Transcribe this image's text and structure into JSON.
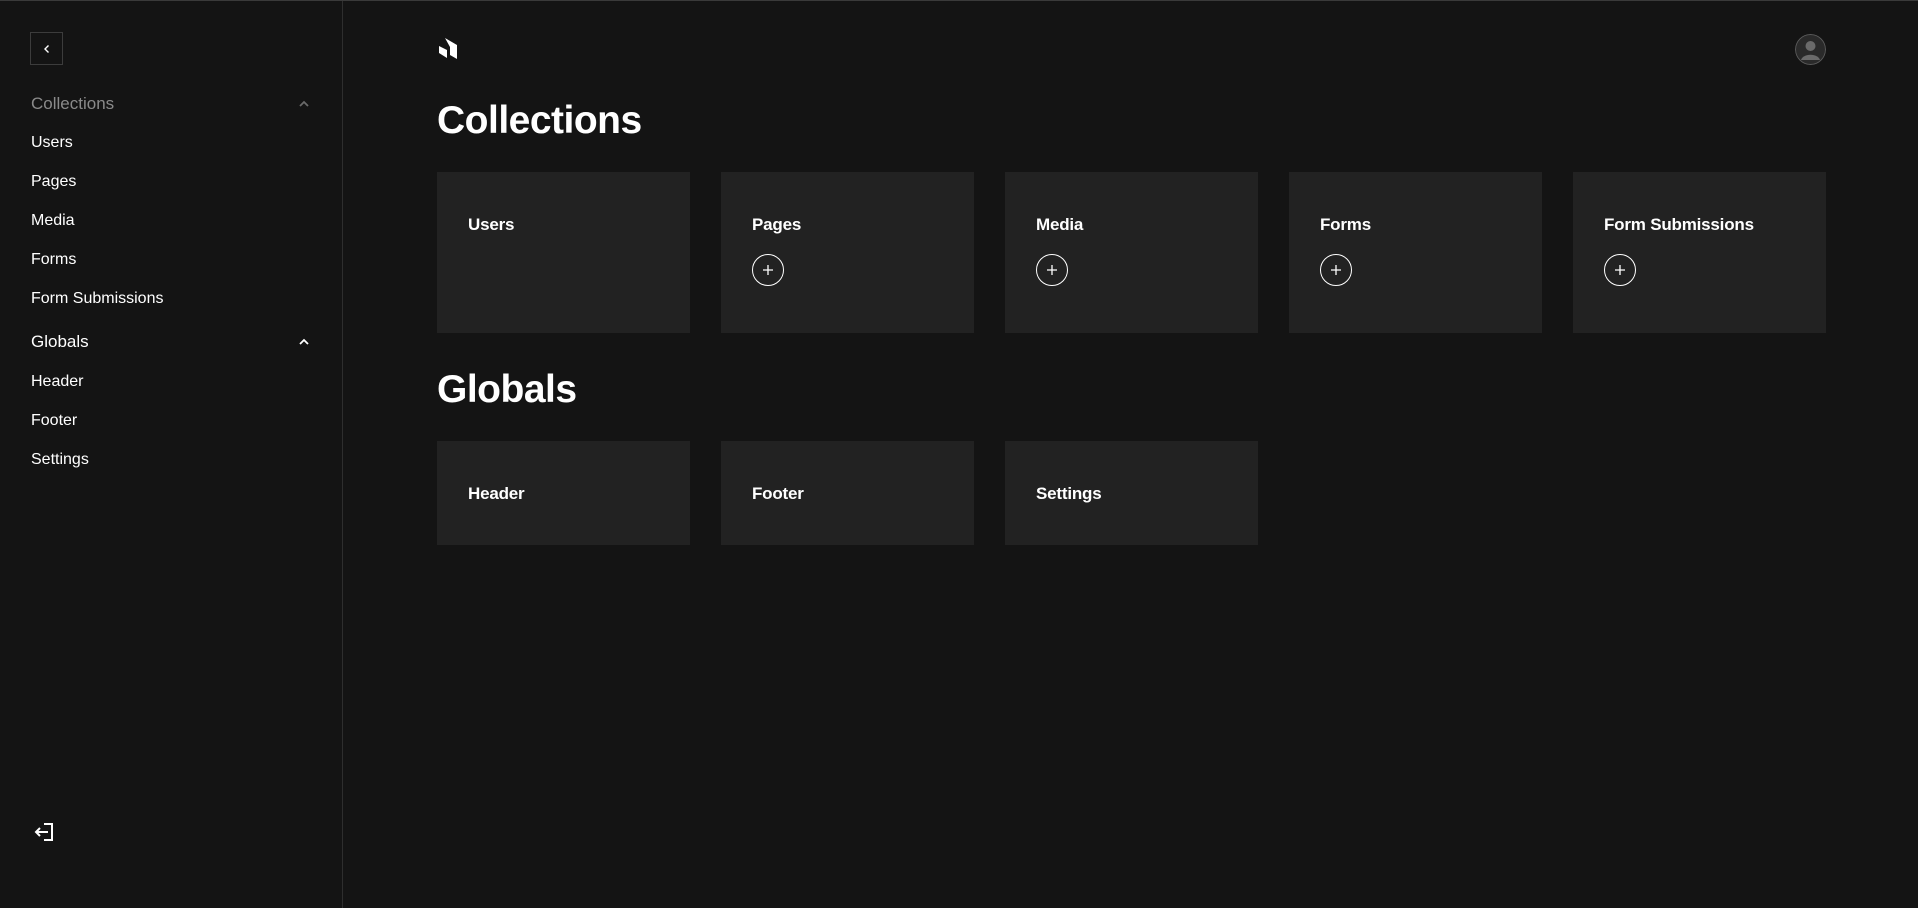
{
  "sidebar": {
    "collapse_icon": "chevron-left-icon",
    "collections_group": {
      "label": "Collections",
      "icon": "chevron-up-icon",
      "items": [
        {
          "label": "Users"
        },
        {
          "label": "Pages"
        },
        {
          "label": "Media"
        },
        {
          "label": "Forms"
        },
        {
          "label": "Form Submissions"
        }
      ]
    },
    "globals_group": {
      "label": "Globals",
      "icon": "chevron-up-icon",
      "items": [
        {
          "label": "Header"
        },
        {
          "label": "Footer"
        },
        {
          "label": "Settings"
        }
      ]
    },
    "logout_icon": "logout-icon"
  },
  "header": {
    "logo_icon": "payload-logo-icon",
    "avatar_icon": "user-avatar-icon"
  },
  "main": {
    "collections": {
      "title": "Collections",
      "cards": [
        {
          "label": "Users",
          "has_add": false
        },
        {
          "label": "Pages",
          "has_add": true
        },
        {
          "label": "Media",
          "has_add": true
        },
        {
          "label": "Forms",
          "has_add": true
        },
        {
          "label": "Form Submissions",
          "has_add": true
        }
      ]
    },
    "globals": {
      "title": "Globals",
      "cards": [
        {
          "label": "Header"
        },
        {
          "label": "Footer"
        },
        {
          "label": "Settings"
        }
      ]
    }
  },
  "colors": {
    "background": "#141414",
    "card": "#222222",
    "text": "#ffffff",
    "muted": "#8a8a8a",
    "border": "#2e2e2e"
  }
}
